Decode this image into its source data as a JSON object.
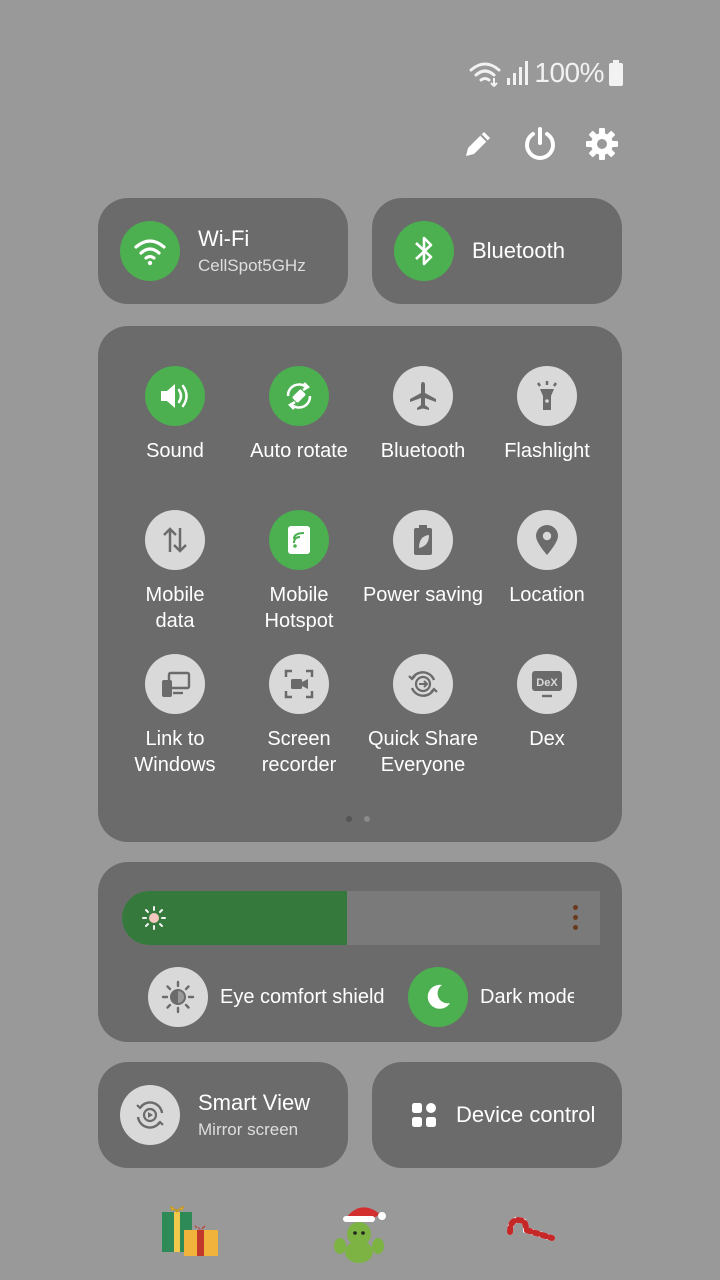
{
  "status_bar": {
    "battery_text": "100%",
    "battery_level": 1.0
  },
  "tiles": {
    "wifi": {
      "label": "Wi-Fi",
      "sub": "CellSpot5GHz"
    },
    "bluetooth": {
      "label": "Bluetooth"
    },
    "smart_view": {
      "label": "Smart View",
      "sub": "Mirror screen"
    },
    "device_control": {
      "label": "Device control"
    }
  },
  "quick_settings": [
    {
      "label": "Sound",
      "icon": "speaker-icon",
      "on": true
    },
    {
      "label": "Auto rotate",
      "icon": "auto-rotate-icon",
      "on": true
    },
    {
      "label": "Bluetooth",
      "icon": "airplane-icon",
      "on": false
    },
    {
      "label": "Flashlight",
      "icon": "flashlight-icon",
      "on": false
    },
    {
      "label": "Mobile\ndata",
      "icon": "mobile-data-icon",
      "on": false
    },
    {
      "label": "Mobile\nHotspot",
      "icon": "hotspot-icon",
      "on": true
    },
    {
      "label": "Power saving",
      "icon": "battery-leaf-icon",
      "on": false
    },
    {
      "label": "Location",
      "icon": "location-pin-icon",
      "on": false
    },
    {
      "label": "Link to\nWindows",
      "icon": "link-to-windows-icon",
      "on": false
    },
    {
      "label": "Screen\nrecorder",
      "icon": "screen-recorder-icon",
      "on": false
    },
    {
      "label": "Quick Share\nEveryone",
      "icon": "quick-share-icon",
      "on": false
    },
    {
      "label": "Dex",
      "icon": "dex-icon",
      "on": false
    }
  ],
  "pager": {
    "pages": 2,
    "current": 1
  },
  "brightness": {
    "level": 0.47
  },
  "eye_comfort": {
    "label": "Eye comfort shield",
    "on": false
  },
  "dark_mode": {
    "label": "Dark mode",
    "on": true
  },
  "colors": {
    "accent": "#4caf50",
    "slider_fill": "#357a3c",
    "card": "#6b6b6b",
    "background": "#999999"
  }
}
